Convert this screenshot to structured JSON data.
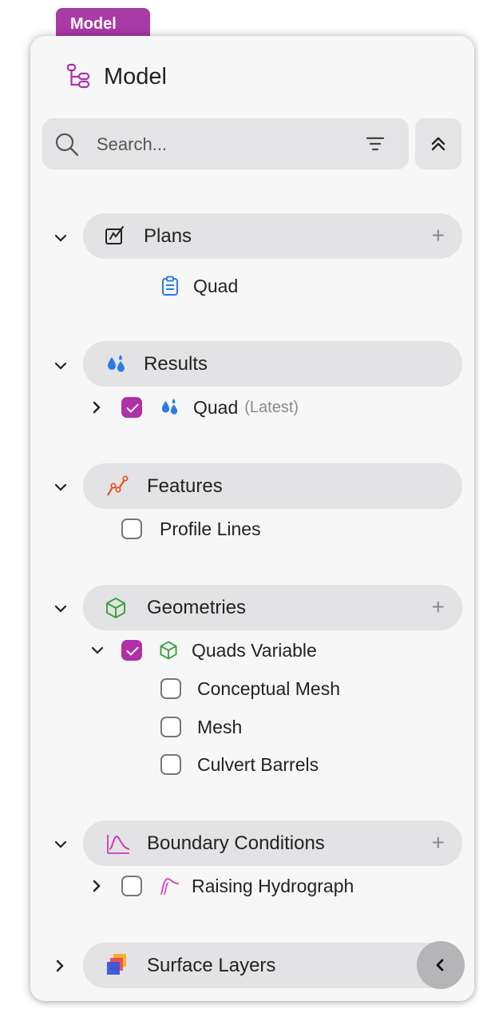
{
  "tab": {
    "label": "Model"
  },
  "header": {
    "title": "Model",
    "icon": "model-tree-icon"
  },
  "search": {
    "placeholder": "Search..."
  },
  "colors": {
    "accent": "#b030a8",
    "tab": "#a93aa6",
    "pill": "#e3e3e5",
    "blue": "#2c7be5",
    "green": "#3aa33a",
    "pink": "#d23ab8",
    "orange": "#e0502a"
  },
  "sections": {
    "plans": {
      "label": "Plans",
      "items": [
        {
          "label": "Quad",
          "icon": "clipboard-icon"
        }
      ]
    },
    "results": {
      "label": "Results",
      "items": [
        {
          "label": "Quad",
          "suffix": "(Latest)",
          "checked": true
        }
      ]
    },
    "features": {
      "label": "Features",
      "items": [
        {
          "label": "Profile Lines",
          "checked": false
        }
      ]
    },
    "geometries": {
      "label": "Geometries",
      "items": [
        {
          "label": "Quads Variable",
          "checked": true,
          "children": [
            {
              "label": "Conceptual Mesh",
              "checked": false
            },
            {
              "label": "Mesh",
              "checked": false
            },
            {
              "label": "Culvert Barrels",
              "checked": false
            }
          ]
        }
      ]
    },
    "boundary": {
      "label": "Boundary Conditions",
      "items": [
        {
          "label": "Raising Hydrograph",
          "checked": false
        }
      ]
    },
    "surface": {
      "label": "Surface Layers"
    }
  }
}
